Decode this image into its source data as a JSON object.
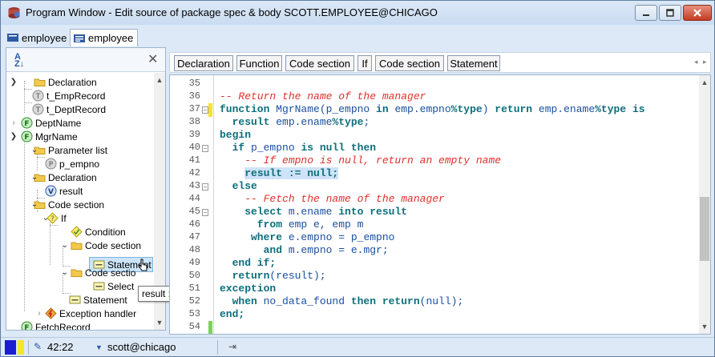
{
  "window": {
    "title": "Program Window - Edit source of package spec & body SCOTT.EMPLOYEE@CHICAGO"
  },
  "tabs": [
    {
      "label": "employee",
      "active": false
    },
    {
      "label": "employee",
      "active": true
    }
  ],
  "tree": {
    "nodes": [
      {
        "label": "Declaration",
        "icon": "folder-icon"
      },
      {
        "label": "t_EmpRecord",
        "icon": "type-icon",
        "badge": "T"
      },
      {
        "label": "t_DeptRecord",
        "icon": "type-icon",
        "badge": "T"
      },
      {
        "label": "DeptName",
        "icon": "function-icon",
        "badge": "F"
      },
      {
        "label": "MgrName",
        "icon": "function-icon",
        "badge": "F"
      },
      {
        "label": "Parameter list",
        "icon": "folder-icon"
      },
      {
        "label": "p_empno",
        "icon": "parameter-icon",
        "badge": "P"
      },
      {
        "label": "Declaration",
        "icon": "folder-icon"
      },
      {
        "label": "result",
        "icon": "variable-icon",
        "badge": "V"
      },
      {
        "label": "Code section",
        "icon": "folder-icon"
      },
      {
        "label": "If",
        "icon": "if-icon",
        "badge": "?"
      },
      {
        "label": "Condition",
        "icon": "condition-icon"
      },
      {
        "label": "Code section",
        "icon": "folder-icon"
      },
      {
        "label": "Statement",
        "icon": "statement-icon"
      },
      {
        "label": "Code sectio",
        "icon": "folder-icon"
      },
      {
        "label": "Select",
        "icon": "statement-icon"
      },
      {
        "label": "Statement",
        "icon": "statement-icon"
      },
      {
        "label": "Exception handler",
        "icon": "exception-icon"
      },
      {
        "label": "FetchRecord",
        "icon": "function-icon",
        "badge": "F"
      }
    ],
    "tooltip": "result := null;"
  },
  "breadcrumbs": [
    "Declaration",
    "Function",
    "Code section",
    "If",
    "Code section",
    "Statement"
  ],
  "editor": {
    "line_numbers": [
      "35",
      "36",
      "37",
      "38",
      "39",
      "40",
      "41",
      "42",
      "43",
      "44",
      "45",
      "46",
      "47",
      "48",
      "49",
      "50",
      "51",
      "52",
      "53",
      "54"
    ],
    "lines": [
      [],
      [
        {
          "t": "-- Return the name of the manager",
          "c": "cm"
        }
      ],
      [
        {
          "t": "function ",
          "c": "kw"
        },
        {
          "t": "MgrName(p_empno ",
          "c": "tx"
        },
        {
          "t": "in ",
          "c": "kw"
        },
        {
          "t": "emp.empno",
          "c": "tx"
        },
        {
          "t": "%type",
          "c": "kw"
        },
        {
          "t": ") ",
          "c": "tx"
        },
        {
          "t": "return ",
          "c": "kw"
        },
        {
          "t": "emp.ename",
          "c": "tx"
        },
        {
          "t": "%type ",
          "c": "kw"
        },
        {
          "t": "is",
          "c": "kw"
        }
      ],
      [
        {
          "t": "  result ",
          "c": "kw"
        },
        {
          "t": "emp.ename",
          "c": "tx"
        },
        {
          "t": "%type",
          "c": "kw"
        },
        {
          "t": ";",
          "c": "tx"
        }
      ],
      [
        {
          "t": "begin",
          "c": "kw"
        }
      ],
      [
        {
          "t": "  if ",
          "c": "kw"
        },
        {
          "t": "p_empno ",
          "c": "tx"
        },
        {
          "t": "is null then",
          "c": "kw"
        }
      ],
      [
        {
          "t": "    -- If empno is null, return an empty name",
          "c": "cm"
        }
      ],
      [
        {
          "t": "    ",
          "c": "tx"
        },
        {
          "t": "result := null;",
          "c": "kw hl"
        }
      ],
      [
        {
          "t": "  else",
          "c": "kw"
        }
      ],
      [
        {
          "t": "    -- Fetch the name of the manager",
          "c": "cm"
        }
      ],
      [
        {
          "t": "    select ",
          "c": "kw"
        },
        {
          "t": "m.ename ",
          "c": "tx"
        },
        {
          "t": "into result",
          "c": "kw"
        }
      ],
      [
        {
          "t": "      from ",
          "c": "kw"
        },
        {
          "t": "emp e, emp m",
          "c": "tx"
        }
      ],
      [
        {
          "t": "     where ",
          "c": "kw"
        },
        {
          "t": "e.empno = p_empno",
          "c": "tx"
        }
      ],
      [
        {
          "t": "       and ",
          "c": "kw"
        },
        {
          "t": "m.empno = e.mgr;",
          "c": "tx"
        }
      ],
      [
        {
          "t": "  end if;",
          "c": "kw"
        }
      ],
      [
        {
          "t": "  return",
          "c": "kw"
        },
        {
          "t": "(result);",
          "c": "tx"
        }
      ],
      [
        {
          "t": "exception",
          "c": "kw"
        }
      ],
      [
        {
          "t": "  when ",
          "c": "kw"
        },
        {
          "t": "no_data_found ",
          "c": "tx"
        },
        {
          "t": "then return",
          "c": "kw"
        },
        {
          "t": "(null);",
          "c": "tx"
        }
      ],
      [
        {
          "t": "end;",
          "c": "kw"
        }
      ],
      []
    ]
  },
  "statusbar": {
    "position": "42:22",
    "connection": "scott@chicago"
  },
  "colors": {
    "keyword": "#0d6f7c",
    "comment": "#e0302b",
    "text": "#1a4fa0",
    "highlight": "#cfe2f7"
  }
}
